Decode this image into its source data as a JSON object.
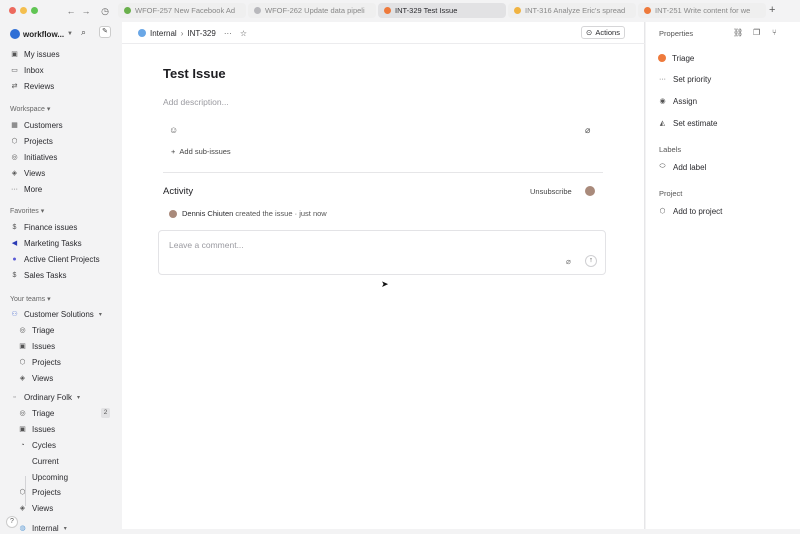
{
  "tabs": [
    {
      "label": "WFOF-257 New Facebook Ad",
      "color": "#6ab04c",
      "active": false
    },
    {
      "label": "WFOF-262 Update data pipeli",
      "color": "#b8b8bc",
      "active": false
    },
    {
      "label": "INT-329 Test Issue",
      "color": "#ee7a3c",
      "active": true
    },
    {
      "label": "INT-316 Analyze Eric's spread",
      "color": "#f0b342",
      "active": false
    },
    {
      "label": "INT-251 Write content for we",
      "color": "#ee7a3c",
      "active": false
    }
  ],
  "sidebar": {
    "workspace_name": "workflow...",
    "top_items": [
      {
        "label": "My issues",
        "icon": "my-issues-icon",
        "glyph": "▣"
      },
      {
        "label": "Inbox",
        "icon": "inbox-icon",
        "glyph": "▭"
      },
      {
        "label": "Reviews",
        "icon": "reviews-icon",
        "glyph": "⇄"
      }
    ],
    "workspace_section": "Workspace",
    "workspace_items": [
      {
        "label": "Customers",
        "icon": "customers-icon",
        "glyph": "▦"
      },
      {
        "label": "Projects",
        "icon": "projects-icon",
        "glyph": "⬡"
      },
      {
        "label": "Initiatives",
        "icon": "initiatives-icon",
        "glyph": "◎"
      },
      {
        "label": "Views",
        "icon": "views-icon",
        "glyph": "◈"
      },
      {
        "label": "More",
        "icon": "more-icon",
        "glyph": "···"
      }
    ],
    "favorites_section": "Favorites",
    "favorites": [
      {
        "label": "Finance issues",
        "icon": "dollar-icon",
        "glyph": "$",
        "color": "#555"
      },
      {
        "label": "Marketing Tasks",
        "icon": "megaphone-icon",
        "glyph": "◀",
        "color": "#2b3bb5"
      },
      {
        "label": "Active Client Projects",
        "icon": "project-circle-icon",
        "glyph": "●",
        "color": "#5b5bd6"
      },
      {
        "label": "Sales Tasks",
        "icon": "dollar-icon",
        "glyph": "$",
        "color": "#555"
      }
    ],
    "teams_section": "Your teams",
    "team1": {
      "label": "Customer Solutions",
      "items": [
        {
          "label": "Triage",
          "icon": "triage-icon",
          "glyph": "◎"
        },
        {
          "label": "Issues",
          "icon": "issues-icon",
          "glyph": "▣"
        },
        {
          "label": "Projects",
          "icon": "projects-icon",
          "glyph": "⬡"
        },
        {
          "label": "Views",
          "icon": "views-icon",
          "glyph": "◈"
        }
      ]
    },
    "team2": {
      "label": "Ordinary Folk",
      "items": [
        {
          "label": "Triage",
          "icon": "triage-icon",
          "glyph": "◎",
          "badge": "2"
        },
        {
          "label": "Issues",
          "icon": "issues-icon",
          "glyph": "▣"
        },
        {
          "label": "Cycles",
          "icon": "cycles-icon",
          "glyph": "◔"
        }
      ],
      "cycles": [
        "Current",
        "Upcoming"
      ],
      "more_items": [
        {
          "label": "Projects",
          "icon": "projects-icon",
          "glyph": "⬡"
        },
        {
          "label": "Views",
          "icon": "views-icon",
          "glyph": "◈"
        }
      ]
    },
    "team3_label": "Internal"
  },
  "breadcrumb": {
    "team": "Internal",
    "issue_id": "INT-329"
  },
  "actions_label": "Actions",
  "issue": {
    "title": "Test Issue",
    "description_placeholder": "Add description...",
    "add_sub_issues": "Add sub-issues"
  },
  "activity": {
    "title": "Activity",
    "unsubscribe": "Unsubscribe",
    "log_user": "Dennis Chiuten",
    "log_text": "created the issue",
    "log_time": "just now",
    "comment_placeholder": "Leave a comment..."
  },
  "properties": {
    "title": "Properties",
    "status": "Triage",
    "priority": "Set priority",
    "assign": "Assign",
    "estimate": "Set estimate",
    "labels_section": "Labels",
    "add_label": "Add label",
    "project_section": "Project",
    "add_project": "Add to project"
  }
}
